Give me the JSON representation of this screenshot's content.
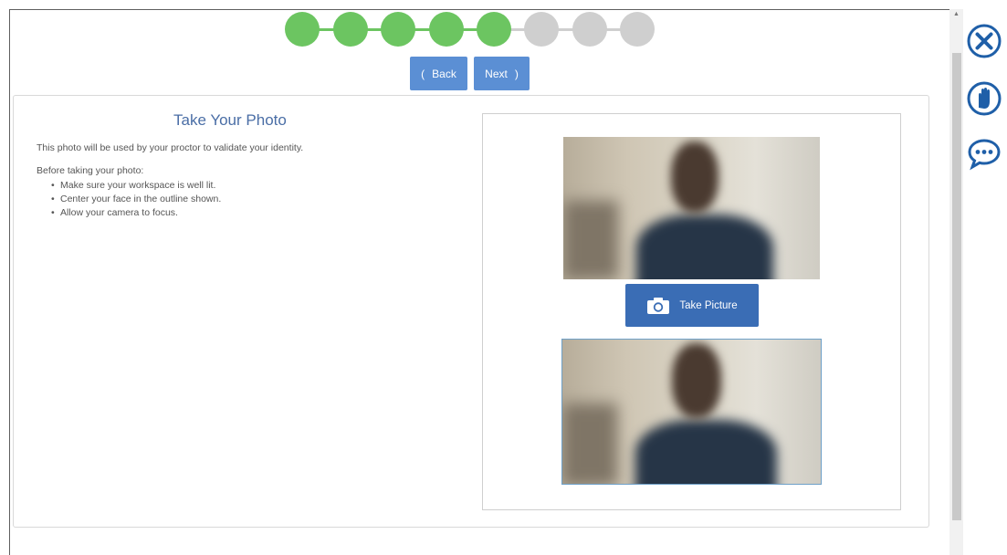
{
  "progress": {
    "steps": [
      "done",
      "done",
      "done",
      "done",
      "done",
      "todo",
      "todo",
      "todo"
    ],
    "colors": {
      "done": "#6cc561",
      "todo": "#cfcfcf"
    }
  },
  "nav": {
    "back_arrow": "(",
    "back_label": "Back",
    "next_label": "Next",
    "next_arrow": ")"
  },
  "content": {
    "title": "Take Your Photo",
    "description": "This photo will be used by your proctor to validate your identity.",
    "before_label": "Before taking your photo:",
    "tips": [
      "Make sure your workspace is well lit.",
      "Center your face in the outline shown.",
      "Allow your camera to focus."
    ]
  },
  "camera": {
    "take_picture_label": "Take Picture",
    "icon": "camera-icon"
  },
  "tools": {
    "icons": [
      "close-icon",
      "raise-hand-icon",
      "chat-icon"
    ],
    "accent": "#1f5fa8"
  }
}
